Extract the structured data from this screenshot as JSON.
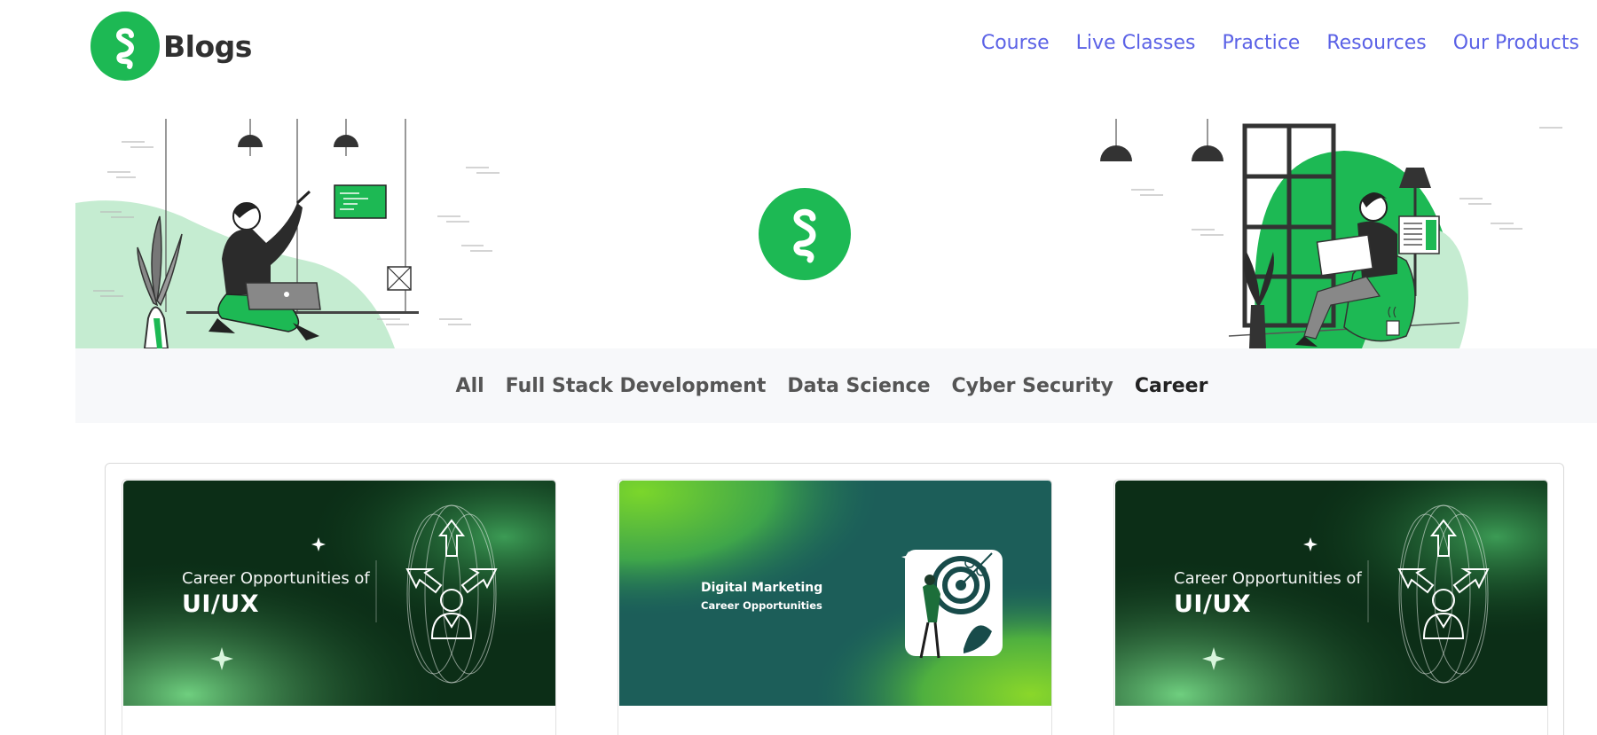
{
  "header": {
    "logo_text": "Blogs",
    "nav": [
      {
        "label": "Course"
      },
      {
        "label": "Live Classes"
      },
      {
        "label": "Practice"
      },
      {
        "label": "Resources"
      },
      {
        "label": "Our Products"
      }
    ]
  },
  "categories": [
    {
      "label": "All",
      "active": false
    },
    {
      "label": "Full Stack Development",
      "active": false
    },
    {
      "label": "Data Science",
      "active": false
    },
    {
      "label": "Cyber Security",
      "active": false
    },
    {
      "label": "Career",
      "active": true
    }
  ],
  "cards": [
    {
      "line1": "Career Opportunities of",
      "line2": "UI/UX",
      "style": "uiux"
    },
    {
      "line1": "Digital Marketing",
      "line2": "Career Opportunities",
      "style": "dm"
    },
    {
      "line1": "Career Opportunities of",
      "line2": "UI/UX",
      "style": "uiux"
    }
  ],
  "colors": {
    "brand_green": "#1db954",
    "nav_link": "#5b62e6",
    "category_bar_bg": "#f7f8fa"
  }
}
